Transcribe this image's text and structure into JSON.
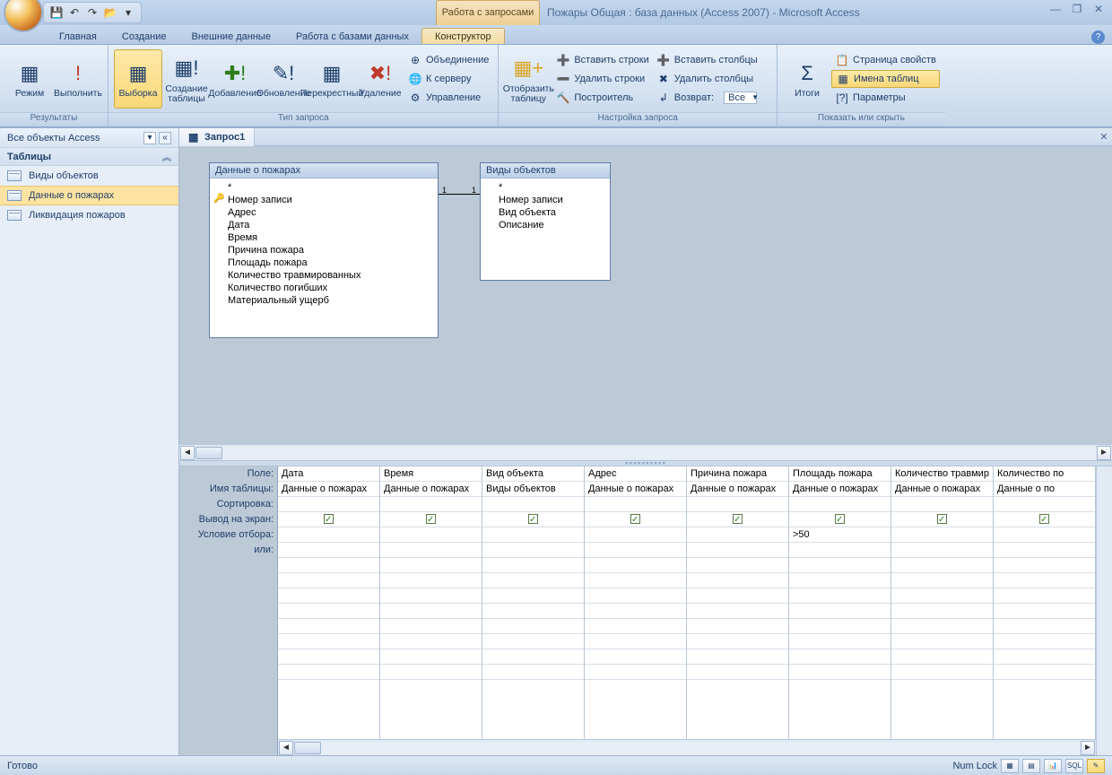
{
  "title": "Пожары Общая : база данных (Access 2007) - Microsoft Access",
  "contextual_tab_group": "Работа с запросами",
  "qat": {
    "undo": "↶",
    "redo": "↷",
    "save": "💾",
    "open": "📂",
    "more": "▾"
  },
  "tabs": {
    "home": "Главная",
    "create": "Создание",
    "external": "Внешние данные",
    "dbwork": "Работа с базами данных",
    "designer": "Конструктор"
  },
  "ribbon": {
    "g1_label": "Результаты",
    "g1_view": "Режим",
    "g1_run": "Выполнить",
    "g2_label": "Тип запроса",
    "g2_select": "Выборка",
    "g2_maketable": "Создание\nтаблицы",
    "g2_append": "Добавление",
    "g2_update": "Обновление",
    "g2_cross": "Перекрестный",
    "g2_delete": "Удаление",
    "g2_join": "Объединение",
    "g2_server": "К серверу",
    "g2_manage": "Управление",
    "g3_label": "Настройка запроса",
    "g3_show": "Отобразить\nтаблицу",
    "g3_insrow": "Вставить строки",
    "g3_delrow": "Удалить строки",
    "g3_builder": "Построитель",
    "g3_inscol": "Вставить столбцы",
    "g3_delcol": "Удалить столбцы",
    "g3_return": "Возврат:",
    "g3_return_val": "Все",
    "g4_label": "Показать или скрыть",
    "g4_totals": "Итоги",
    "g4_propsheet": "Страница свойств",
    "g4_tablenames": "Имена таблиц",
    "g4_params": "Параметры"
  },
  "nav": {
    "header": "Все объекты Access",
    "section": "Таблицы",
    "items": [
      "Виды объектов",
      "Данные о пожарах",
      "Ликвидация пожаров"
    ]
  },
  "doc_tab": "Запрос1",
  "tables": {
    "t1_title": "Данные о пожарах",
    "t1_fields": [
      "*",
      "Номер записи",
      "Адрес",
      "Дата",
      "Время",
      "Причина пожара",
      "Площадь пожара",
      "Количество травмированных",
      "Количество погибших",
      "Материальный ущерб"
    ],
    "t2_title": "Виды объектов",
    "t2_fields": [
      "*",
      "Номер записи",
      "Вид объекта",
      "Описание"
    ]
  },
  "relation": {
    "left": "1",
    "right": "1"
  },
  "grid_labels": {
    "field": "Поле:",
    "table": "Имя таблицы:",
    "sort": "Сортировка:",
    "show": "Вывод на экран:",
    "criteria": "Условие отбора:",
    "or": "или:"
  },
  "grid_cols": [
    {
      "field": "Дата",
      "table": "Данные о пожарах",
      "criteria": ""
    },
    {
      "field": "Время",
      "table": "Данные о пожарах",
      "criteria": ""
    },
    {
      "field": "Вид объекта",
      "table": "Виды объектов",
      "criteria": ""
    },
    {
      "field": "Адрес",
      "table": "Данные о пожарах",
      "criteria": ""
    },
    {
      "field": "Причина пожара",
      "table": "Данные о пожарах",
      "criteria": ""
    },
    {
      "field": "Площадь пожара",
      "table": "Данные о пожарах",
      "criteria": ">50"
    },
    {
      "field": "Количество травмир",
      "table": "Данные о пожарах",
      "criteria": ""
    },
    {
      "field": "Количество по",
      "table": "Данные о по",
      "criteria": ""
    }
  ],
  "status": {
    "ready": "Готово",
    "numlock": "Num Lock",
    "sql": "SQL"
  }
}
